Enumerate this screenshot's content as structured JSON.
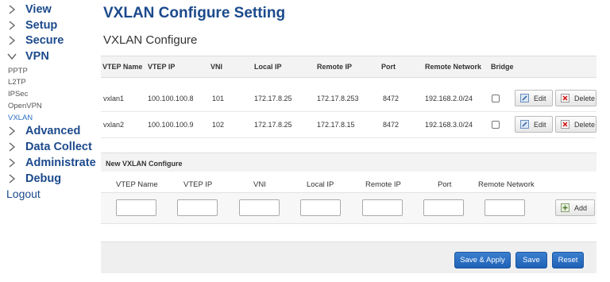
{
  "sidebar": {
    "items": [
      {
        "label": "View",
        "icon": "chevron-right-icon"
      },
      {
        "label": "Setup",
        "icon": "chevron-right-icon"
      },
      {
        "label": "Secure",
        "icon": "chevron-right-icon"
      },
      {
        "label": "VPN",
        "icon": "chevron-down-icon",
        "expanded": true
      },
      {
        "label": "Advanced",
        "icon": "chevron-right-icon"
      },
      {
        "label": "Data Collect",
        "icon": "chevron-right-icon"
      },
      {
        "label": "Administrate",
        "icon": "chevron-right-icon"
      },
      {
        "label": "Debug",
        "icon": "chevron-right-icon"
      }
    ],
    "vpn_subitems": [
      "PPTP",
      "L2TP",
      "IPSec",
      "OpenVPN",
      "VXLAN"
    ],
    "active_subitem": "VXLAN",
    "logout": "Logout"
  },
  "page": {
    "title": "VXLAN Configure Setting",
    "section_title": "VXLAN Configure"
  },
  "table": {
    "headers": [
      "VTEP Name",
      "VTEP IP",
      "VNI",
      "Local IP",
      "Remote IP",
      "Port",
      "Remote Network",
      "Bridge"
    ],
    "rows": [
      {
        "vtep_name": "vxlan1",
        "vtep_ip": "100.100.100.8",
        "vni": "101",
        "local_ip": "172.17.8.25",
        "remote_ip": "172.17.8.253",
        "port": "8472",
        "remote_network": "192.168.2.0/24",
        "bridge": false
      },
      {
        "vtep_name": "vxlan2",
        "vtep_ip": "100.100.100.9",
        "vni": "102",
        "local_ip": "172.17.8.25",
        "remote_ip": "172.17.8.15",
        "port": "8472",
        "remote_network": "192.168.3.0/24",
        "bridge": false
      }
    ],
    "edit_label": "Edit",
    "delete_label": "Delete"
  },
  "new_config": {
    "title": "New VXLAN Configure",
    "columns": [
      "VTEP Name",
      "VTEP IP",
      "VNI",
      "Local IP",
      "Remote IP",
      "Port",
      "Remote Network"
    ],
    "values": [
      "",
      "",
      "",
      "",
      "",
      "",
      ""
    ],
    "add_label": "Add"
  },
  "footer": {
    "save_apply_label": "Save & Apply",
    "save_label": "Save",
    "reset_label": "Reset"
  },
  "colors": {
    "accent": "#1c4a8c",
    "primary_button": "#2a6fc4",
    "active_link": "#2a6fc4"
  }
}
